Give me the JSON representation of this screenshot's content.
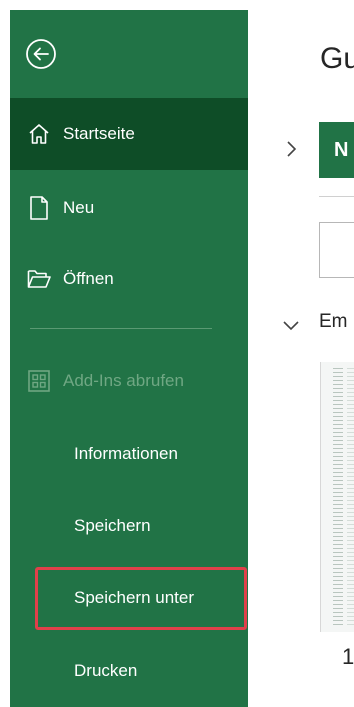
{
  "sidebar": {
    "items": [
      {
        "label": "Startseite",
        "icon": "home-icon"
      },
      {
        "label": "Neu",
        "icon": "new-document-icon"
      },
      {
        "label": "Öffnen",
        "icon": "open-folder-icon"
      },
      {
        "label": "Add-Ins abrufen",
        "icon": "add-ins-icon"
      },
      {
        "label": "Informationen"
      },
      {
        "label": "Speichern"
      },
      {
        "label": "Speichern unter"
      },
      {
        "label": "Drucken"
      }
    ],
    "back_icon": "back-arrow-icon",
    "color": "#217346",
    "active_color": "#0e4d27",
    "highlight_color": "#e0404a"
  },
  "main": {
    "title": "Gu",
    "new_button": "N",
    "section_title": "Em",
    "bottom_text": "1"
  }
}
